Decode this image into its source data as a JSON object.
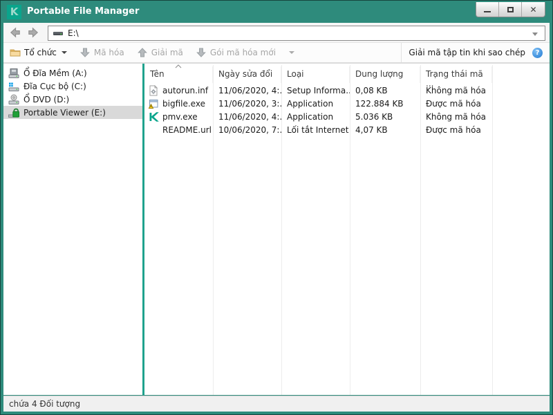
{
  "window": {
    "title": "Portable File Manager"
  },
  "navbar": {
    "address": "E:\\"
  },
  "toolbar": {
    "organize_label": "Tổ chức",
    "encrypt_label": "Mã hóa",
    "decrypt_label": "Giải mã",
    "new_package_label": "Gói mã hóa mới",
    "decrypt_on_copy_label": "Giải mã tập tin khi sao chép",
    "help_glyph": "?"
  },
  "sidebar": {
    "items": [
      {
        "label": "Ổ Đĩa Mềm (A:)",
        "icon": "floppy-drive-icon",
        "selected": false
      },
      {
        "label": "Đĩa Cục bộ (C:)",
        "icon": "local-disk-icon",
        "selected": false
      },
      {
        "label": "Ổ DVD (D:)",
        "icon": "dvd-drive-icon",
        "selected": false
      },
      {
        "label": "Portable Viewer (E:)",
        "icon": "lock-drive-icon",
        "selected": true
      }
    ]
  },
  "filelist": {
    "columns": [
      "Tên",
      "Ngày sửa đổi",
      "Loại",
      "Dung lượng",
      "Trạng thái mã ..."
    ],
    "rows": [
      {
        "icon": "inf-file-icon",
        "name": "autorun.inf",
        "modified": "11/06/2020, 4:...",
        "type": "Setup Informa...",
        "size": "0,08 KB",
        "status": "Không mã hóa"
      },
      {
        "icon": "exe-file-icon",
        "name": "bigfile.exe",
        "modified": "11/06/2020, 3:...",
        "type": "Application",
        "size": "122.884 KB",
        "status": "Được mã hóa"
      },
      {
        "icon": "kaspersky-k-icon",
        "name": "pmv.exe",
        "modified": "11/06/2020, 4:...",
        "type": "Application",
        "size": "5.036 KB",
        "status": "Không mã hóa"
      },
      {
        "icon": "no-icon",
        "name": "README.url",
        "modified": "10/06/2020, 7:...",
        "type": "Lối tắt Internet",
        "size": "4,07 KB",
        "status": "Được mã hóa"
      }
    ]
  },
  "statusbar": {
    "text": "chứa 4 Đối tượng"
  },
  "colors": {
    "titlebar": "#2E8B7C",
    "logo": "#0AA58C",
    "splitter": "#1FA28D",
    "selection": "#D9D9D9",
    "lock_green": "#21A038",
    "help_blue": "#2F8FE0",
    "folder_tan": "#F3C878"
  }
}
